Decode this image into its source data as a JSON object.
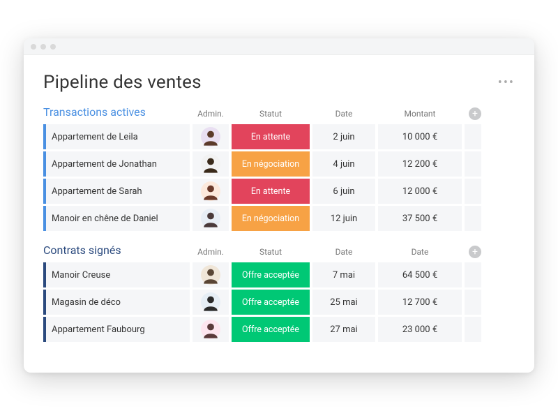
{
  "page_title": "Pipeline des ventes",
  "columns": {
    "admin": "Admin.",
    "status": "Statut",
    "date": "Date",
    "amount": "Montant",
    "date2": "Date"
  },
  "sections": [
    {
      "title": "Transactions actives",
      "accent": "blue",
      "amount_header": "Montant",
      "rows": [
        {
          "name": "Appartement de Leila",
          "status": "En attente",
          "status_color": "red",
          "date": "2 juin",
          "amount": "10 000 €",
          "avatar_bg": "#e9dff2",
          "avatar_fg": "#5b3a2a"
        },
        {
          "name": "Appartement de Jonathan",
          "status": "En négociation",
          "status_color": "orange",
          "date": "4 juin",
          "amount": "12 200 €",
          "avatar_bg": "#f2f2f2",
          "avatar_fg": "#3a2a1a"
        },
        {
          "name": "Appartement de Sarah",
          "status": "En attente",
          "status_color": "red",
          "date": "6 juin",
          "amount": "12 000 €",
          "avatar_bg": "#fce9dc",
          "avatar_fg": "#6b3a2a"
        },
        {
          "name": "Manoir en chêne de Daniel",
          "status": "En négociation",
          "status_color": "orange",
          "date": "12 juin",
          "amount": "37 500 €",
          "avatar_bg": "#e8eef5",
          "avatar_fg": "#4a3a3a"
        }
      ]
    },
    {
      "title": "Contrats signés",
      "accent": "navy",
      "amount_header": "Date",
      "rows": [
        {
          "name": "Manoir Creuse",
          "status": "Offre acceptée",
          "status_color": "green",
          "date": "7 mai",
          "amount": "64 500 €",
          "avatar_bg": "#f0e6d8",
          "avatar_fg": "#5a4635"
        },
        {
          "name": "Magasin de déco",
          "status": "Offre acceptée",
          "status_color": "green",
          "date": "25 mai",
          "amount": "12 700 €",
          "avatar_bg": "#e6eef5",
          "avatar_fg": "#2a2a2a"
        },
        {
          "name": "Appartement Faubourg",
          "status": "Offre acceptée",
          "status_color": "green",
          "date": "27 mai",
          "amount": "23 000 €",
          "avatar_bg": "#fde6ef",
          "avatar_fg": "#5a3a3a"
        }
      ]
    }
  ]
}
